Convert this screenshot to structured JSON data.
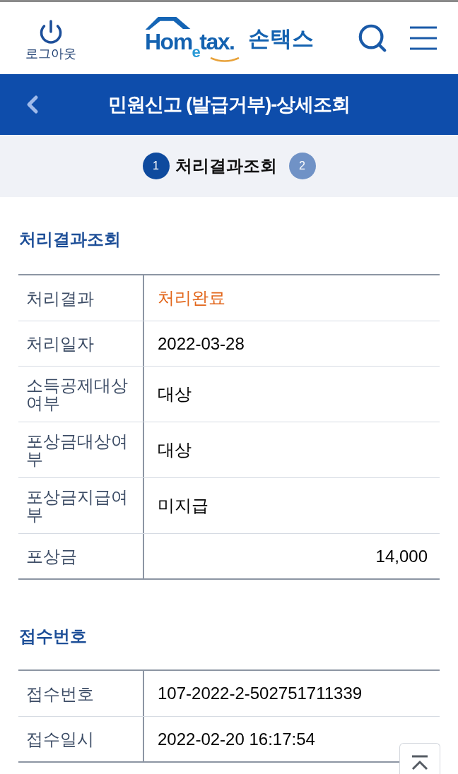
{
  "header": {
    "logout_label": "로그아웃",
    "logo_text": "Hom$_{e}$tax.",
    "logo_korean": "손택스"
  },
  "title_bar": {
    "title": "민원신고 (발급거부)-상세조회"
  },
  "steps": [
    {
      "number": "1",
      "label": "처리결과조회",
      "selected": true
    },
    {
      "number": "2",
      "selected": false
    }
  ],
  "sections": [
    {
      "title": "처리결과조회",
      "rows": [
        {
          "label": "처리결과",
          "value": "처리완료",
          "kind": "status"
        },
        {
          "label": "처리일자",
          "value": "2022-03-28",
          "kind": "text"
        },
        {
          "label": "소득공제대상여부",
          "value": "대상",
          "kind": "text"
        },
        {
          "label": "포상금대상여부",
          "value": "대상",
          "kind": "text"
        },
        {
          "label": "포상금지급여부",
          "value": "미지급",
          "kind": "text"
        },
        {
          "label": "포상금",
          "value": "14,000",
          "kind": "amount"
        }
      ]
    },
    {
      "title": "접수번호",
      "rows": [
        {
          "label": "접수번호",
          "value": "107-2022-2-502751711339",
          "kind": "text"
        },
        {
          "label": "접수일시",
          "value": "2022-02-20 16:17:54",
          "kind": "text"
        }
      ]
    }
  ]
}
